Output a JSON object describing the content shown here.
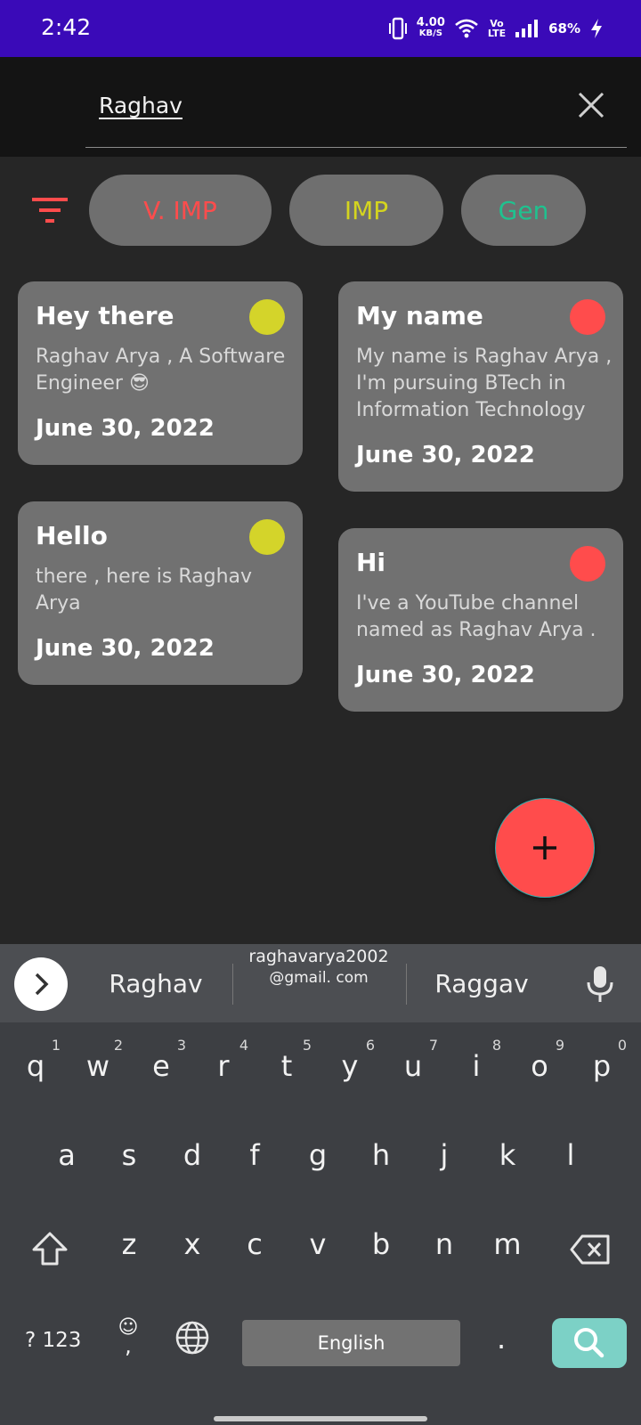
{
  "status_bar": {
    "time": "2:42",
    "net_speed_value": "4.00",
    "net_speed_unit": "KB/S",
    "volte_line1": "Vo",
    "volte_line2": "LTE",
    "battery": "68%",
    "icons": [
      "vibrate-icon",
      "wifi-icon",
      "signal-icon",
      "charging-icon"
    ]
  },
  "search": {
    "value": "Raghav",
    "clear_icon": "close-icon"
  },
  "filters": {
    "icon": "filter-icon",
    "chips": [
      {
        "label": "V. IMP",
        "color": "#ff4c4c"
      },
      {
        "label": "IMP",
        "color": "#d4d41f"
      },
      {
        "label": "Gen",
        "color": "#1fc28f"
      }
    ]
  },
  "notes": [
    {
      "title": "Hey there",
      "body": "Raghav Arya , A Software Engineer 😎",
      "date": "June 30, 2022",
      "priority_color": "#d4d42a"
    },
    {
      "title": "My name",
      "body": "My name is Raghav Arya , I'm pursuing BTech in Information Technology",
      "date": "June 30, 2022",
      "priority_color": "#ff4c4c"
    },
    {
      "title": "Hello",
      "body": "there , here is Raghav Arya",
      "date": "June 30, 2022",
      "priority_color": "#d4d42a"
    },
    {
      "title": "Hi",
      "body": "I've a YouTube channel named as Raghav Arya .",
      "date": "June 30, 2022",
      "priority_color": "#ff4c4c"
    }
  ],
  "fab": {
    "icon": "plus-icon",
    "color": "#ff4c4c"
  },
  "keyboard": {
    "suggestions": [
      "Raghav",
      "raghavarya2002",
      "@gmail. com",
      "Raggav"
    ],
    "row1": [
      {
        "ch": "q",
        "hint": "1"
      },
      {
        "ch": "w",
        "hint": "2"
      },
      {
        "ch": "e",
        "hint": "3"
      },
      {
        "ch": "r",
        "hint": "4"
      },
      {
        "ch": "t",
        "hint": "5"
      },
      {
        "ch": "y",
        "hint": "6"
      },
      {
        "ch": "u",
        "hint": "7"
      },
      {
        "ch": "i",
        "hint": "8"
      },
      {
        "ch": "o",
        "hint": "9"
      },
      {
        "ch": "p",
        "hint": "0"
      }
    ],
    "row2": [
      "a",
      "s",
      "d",
      "f",
      "g",
      "h",
      "j",
      "k",
      "l"
    ],
    "row3": [
      "z",
      "x",
      "c",
      "v",
      "b",
      "n",
      "m"
    ],
    "symbols_label": "? 123",
    "emoji_label": "☺",
    "comma_label": ",",
    "space_label": "English",
    "period_label": ".",
    "accent_color": "#7cd1c6"
  }
}
